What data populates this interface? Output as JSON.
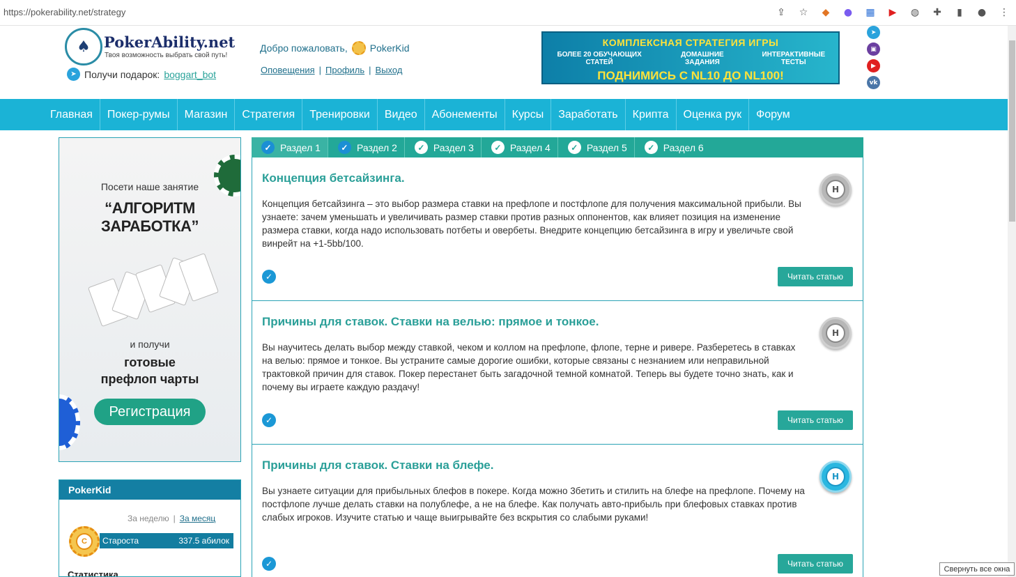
{
  "browser": {
    "url": "https://pokerability.net/strategy"
  },
  "logo": {
    "title": "PokerAbility.net",
    "subtitle": "Твоя возможность выбрать свой путь!"
  },
  "gift": {
    "label": "Получи подарок:",
    "link": "boggart_bot"
  },
  "user": {
    "welcome": "Добро пожаловать,",
    "name": "PokerKid",
    "links": [
      "Оповещения",
      "Профиль",
      "Выход"
    ],
    "separator": "|"
  },
  "banner": {
    "line1": "КОМПЛЕКСНАЯ СТРАТЕГИЯ ИГРЫ",
    "items": [
      "БОЛЕЕ 20 ОБУЧАЮЩИХ СТАТЕЙ",
      "ДОМАШНИЕ ЗАДАНИЯ",
      "ИНТЕРАКТИВНЫЕ ТЕСТЫ"
    ],
    "line3": "ПОДНИМИСЬ С NL10 ДО NL100!"
  },
  "nav": [
    "Главная",
    "Покер-румы",
    "Магазин",
    "Стратегия",
    "Тренировки",
    "Видео",
    "Абонементы",
    "Курсы",
    "Заработать",
    "Крипта",
    "Оценка рук",
    "Форум"
  ],
  "ad": {
    "line1": "Посети наше занятие",
    "line2": "“АЛГОРИТМ ЗАРАБОТКА”",
    "line3": "и получи",
    "line4a": "готовые",
    "line4b": "префлоп чарты",
    "button": "Регистрация"
  },
  "rating": {
    "username": "PokerKid",
    "week": "За неделю",
    "month": "За месяц",
    "rank": "Староста",
    "points": "337.5 абилок",
    "coin_letter": "С",
    "stats": "Статистика"
  },
  "tabs": [
    "Раздел 1",
    "Раздел 2",
    "Раздел 3",
    "Раздел 4",
    "Раздел 5",
    "Раздел 6"
  ],
  "lessons": [
    {
      "title": "Концепция бетсайзинга.",
      "desc": "Концепция бетсайзинга – это выбор размера ставки на префлопе и постфлопе для получения максимальной прибыли. Вы узнаете: зачем уменьшать и увеличивать размер ставки против разных оппонентов, как влияет позиция на изменение размера ставки, когда надо использовать потбеты и овербеты. Внедрите концепцию бетсайзинга в игру и увеличьте свой винрейт на +1-5bb/100.",
      "level": "Н",
      "button": "Читать статью"
    },
    {
      "title": "Причины для ставок. Ставки на велью: прямое и тонкое.",
      "desc": "Вы научитесь делать выбор между ставкой, чеком и коллом на префлопе, флопе, терне и ривере. Разберетесь в ставках на велью: прямое и тонкое. Вы устраните самые дорогие ошибки, которые связаны с незнанием или неправильной трактовкой причин для ставок. Покер перестанет быть загадочной темной комнатой. Теперь вы будете точно знать, как и почему вы играете каждую раздачу!",
      "level": "Н",
      "button": "Читать статью"
    },
    {
      "title": "Причины для ставок. Ставки на блефе.",
      "desc": "Вы узнаете ситуации для прибыльных блефов в покере. Когда можно 3бетить и стилить на блефе на префлопе. Почему на постфлопе лучше делать ставки на полублефе, а не на блефе. Как получать авто-прибыль при блефовых ставках против слабых игроков. Изучите статью и чаще выигрывайте без вскрытия со слабыми руками!",
      "level": "Н",
      "button": "Читать статью"
    }
  ],
  "tooltip": "Свернуть все окна",
  "colors": {
    "nav": "#1bb3d6",
    "tabs": "#23a898",
    "accent": "#2a9f98"
  }
}
